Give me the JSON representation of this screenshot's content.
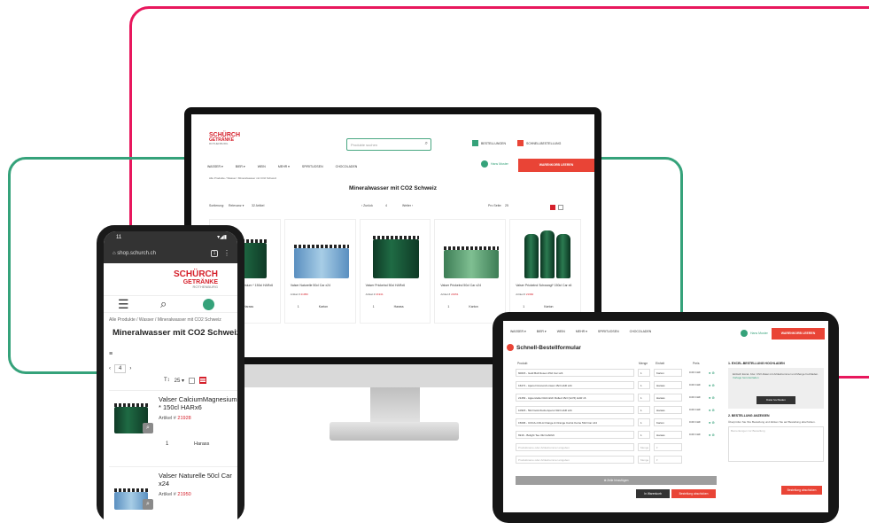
{
  "colors": {
    "brand_red": "#d5202b",
    "accent_red": "#e94436",
    "accent_green": "#35a27a",
    "frame_pink": "#e8175d"
  },
  "desktop": {
    "logo": {
      "line1": "SCHÜRCH",
      "line2": "GETRÄNKE",
      "line3": "ROTHENBURG"
    },
    "search_placeholder": "Produkte suchen",
    "top_buttons": [
      {
        "label": "BESTELLUNGEN",
        "icon": "list-icon"
      },
      {
        "label": "SCHNELLBESTELLUNG",
        "icon": "bolt-icon"
      }
    ],
    "nav": [
      "WASSER ▾",
      "BIER ▾",
      "WEIN",
      "MEHR ▾",
      "SPIRITUOSEN",
      "CHOCOLADEN"
    ],
    "user": "Hans Muster",
    "cart": "WARENKORB LEEREN",
    "breadcrumb": "Alle Produkte / Wasser / Mineralwasser mit CO2 Schweiz",
    "title": "Mineralwasser mit CO2 Schweiz",
    "toolbar": {
      "sort_label": "Sortierung:",
      "sort_value": "Relevanz ▾",
      "count": "32 Artikel",
      "prev": "‹ Zurück",
      "page": "4",
      "next": "Weiter ›",
      "per_page_label": "Pro Seite:",
      "per_page": "25"
    },
    "products": [
      {
        "name": "Valser CalciumMagnesium * 150cl HARx6",
        "artnr_label": "Artikel #",
        "artnr": "21928",
        "qty": "1",
        "unit": "Harass"
      },
      {
        "name": "Valser Naturelle 50cl Car x24",
        "artnr_label": "Artikel #",
        "artnr": "21950",
        "qty": "1",
        "unit": "Karton"
      },
      {
        "name": "Valser Prickelnd 50cl HARx6",
        "artnr_label": "Artikel #",
        "artnr": "21941",
        "qty": "1",
        "unit": "Harass"
      },
      {
        "name": "Valser Prickelnd 50cl Car x24",
        "artnr_label": "Artikel #",
        "artnr": "21951",
        "qty": "1",
        "unit": "Karton"
      },
      {
        "name": "Valser Prickelnd Schwangl* 150cl Car x6",
        "artnr_label": "Artikel #",
        "artnr": "21960",
        "qty": "1",
        "unit": "Karton"
      }
    ]
  },
  "phone": {
    "status_time": "11",
    "status_icons": "▾◢▮",
    "url": "shop.schurch.ch",
    "tab_count": "1",
    "logo": {
      "line1": "SCHÜRCH",
      "line2": "GETRÄNKE",
      "line3": "ROTHENBURG"
    },
    "breadcrumb": "Alle Produkte / Wasser / Mineralwasser mit CO2 Schweiz",
    "title": "Mineralwasser mit CO2 Schweiz",
    "filter_label": "≡",
    "pager": {
      "prev": "‹",
      "page": "4",
      "next": "›"
    },
    "sort": {
      "label": "T↕",
      "per_page": "25 ▾"
    },
    "items": [
      {
        "name": "Valser CalciumMagnesium * 150cl HARx6",
        "artnr_label": "Artikel #",
        "artnr": "21928",
        "qty": "1",
        "unit": "Harass"
      },
      {
        "name": "Valser Naturelle 50cl Car x24",
        "artnr_label": "Artikel #",
        "artnr": "21950",
        "qty": "1",
        "unit": "Karton"
      }
    ]
  },
  "tablet": {
    "nav": [
      "WASSER ▾",
      "BIER ▾",
      "WEIN",
      "MEHR ▾",
      "SPIRITUOSEN",
      "CHOCOLADEN"
    ],
    "user": "Hans Muster",
    "cart": "WARENKORB LEEREN",
    "title": "Schnell-Bestellformular",
    "columns": {
      "product": "Produkt",
      "qty": "Menge",
      "unit": "Einheit",
      "price": "Preis"
    },
    "rows": [
      {
        "product": "60015 - Gold Bull Dosen 25cl Car x24",
        "qty": "1",
        "unit": "Karton",
        "price": "0.00 CHF"
      },
      {
        "product": "16271 - Aperol Crocund Linsan 15cl HAR x24",
        "qty": "1",
        "unit": "Harass",
        "price": "0.00 CHF"
      },
      {
        "product": "21454 - Appenzeller Rohmilch Rolled 15cl (Vol:5) HAR x6",
        "qty": "1",
        "unit": "Harass",
        "price": "0.00 CHF"
      },
      {
        "product": "10915 - 50cl Gold Zucki-Aperol 33cl HAR x24",
        "qty": "1",
        "unit": "Harass",
        "price": "0.00 CHF"
      },
      {
        "product": "15006 - COCA-COLA Orange & Orange Carrot Kerne 50cl Car x24",
        "qty": "1",
        "unit": "Karton",
        "price": "0.00 CHF"
      },
      {
        "product": "6916 - Bolight Tee 33cl HARx6",
        "qty": "1",
        "unit": "Harass",
        "price": "0.00 CHF"
      }
    ],
    "empty_rows": [
      {
        "product": "Produktname oder Artikelnummer eingeben",
        "qty": "Menge",
        "unit": "▾"
      },
      {
        "product": "Produktname oder Artikelnummer eingeben",
        "qty": "Menge",
        "unit": "▾"
      }
    ],
    "add_row": "⊕ Zeile hinzufügen",
    "btn_cart": "In Warenkorb",
    "btn_order": "Bestellung abschicken",
    "side": {
      "h1": "1. EXCEL-BESTELLUNG HOCHLADEN",
      "box_text": "Einfach Excel- bzw. CSV-Datei mit Artikelnummer und Menge hochladen.",
      "box_link": "Vorlage herunterladen",
      "box_button": "Datei hochladen",
      "h2": "2. BESTELLUNG ANZEIGEN",
      "text": "Überprüfen Sie Ihre Bestellung und klicken Sie auf Bestellung abschicken.",
      "textarea_placeholder": "Bemerkungen zur Bestellung",
      "send": "Bestellung abschicken"
    }
  }
}
